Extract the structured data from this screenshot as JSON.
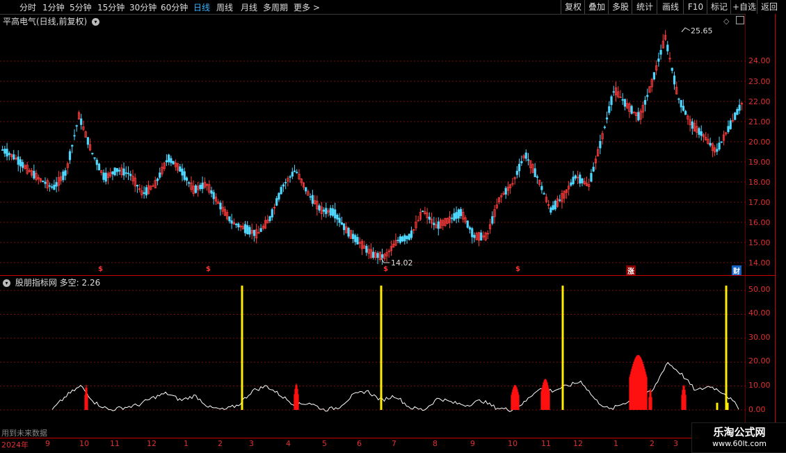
{
  "toolbar": {
    "periods": [
      "分时",
      "1分钟",
      "5分钟",
      "15分钟",
      "30分钟",
      "60分钟",
      "日线",
      "周线",
      "月线",
      "多周期",
      "更多 >"
    ],
    "active_period": "日线",
    "right_buttons": [
      "复权",
      "叠加",
      "多股",
      "统计",
      "画线",
      "F10",
      "标记",
      "+自选",
      "返回"
    ]
  },
  "main": {
    "title": "平高电气(日线,前复权)",
    "high_label": "25.65",
    "low_label": "14.02",
    "y_ticks": [
      "24.00",
      "23.00",
      "22.00",
      "21.00",
      "20.00",
      "19.00",
      "18.00",
      "17.00",
      "16.00",
      "15.00",
      "14.00"
    ],
    "markers": [
      "$",
      "$",
      "$",
      "$",
      "涨",
      "财"
    ]
  },
  "indicator": {
    "name": "股朋指标网",
    "series_label": "多空:",
    "value": "2.26",
    "y_ticks": [
      "50.00",
      "40.00",
      "30.00",
      "20.00",
      "10.00",
      "0.00"
    ]
  },
  "xaxis": {
    "year": "2024年",
    "months": [
      "9",
      "10",
      "11",
      "12",
      "1",
      "2",
      "3",
      "4",
      "5",
      "6",
      "7",
      "8",
      "9",
      "10",
      "11",
      "12",
      "1",
      "2",
      "3"
    ]
  },
  "footer_note": "用到未来数据",
  "watermark": {
    "line1": "乐淘公式网",
    "line2": "www.60lt.com"
  },
  "colors": {
    "up": "#ff3c3c",
    "down": "#4fd8ff",
    "axis": "#e03030",
    "signal": "#ffee00",
    "active": "#34b4ff"
  },
  "chart_data": {
    "type": "candlestick",
    "close_path_samples": [
      19.6,
      19.2,
      18.6,
      18.1,
      17.7,
      18.5,
      21.3,
      19.5,
      18.2,
      18.6,
      18.4,
      17.4,
      17.9,
      19.2,
      18.6,
      17.6,
      17.9,
      16.9,
      16.0,
      15.7,
      15.4,
      16.2,
      17.8,
      18.6,
      17.4,
      16.6,
      16.5,
      15.6,
      15.0,
      14.4,
      14.3,
      15.1,
      15.3,
      16.6,
      15.8,
      16.1,
      16.5,
      15.3,
      15.3,
      17.2,
      17.9,
      19.4,
      18.2,
      16.6,
      17.3,
      18.3,
      17.8,
      20.1,
      22.6,
      21.8,
      21.2,
      23.0,
      25.2,
      22.2,
      20.9,
      20.3,
      19.5,
      20.7,
      21.9
    ],
    "indicator_line_samples": [
      0,
      6,
      10,
      3,
      0,
      1,
      2,
      5,
      7,
      4,
      6,
      1,
      0,
      2,
      8,
      10,
      6,
      2,
      3,
      0,
      1,
      6,
      8,
      4,
      6,
      1,
      0,
      5,
      3,
      2,
      4,
      1,
      0,
      3,
      9,
      8,
      10,
      12,
      4,
      0,
      3,
      5,
      8,
      20,
      15,
      8,
      10,
      7,
      1
    ]
  }
}
